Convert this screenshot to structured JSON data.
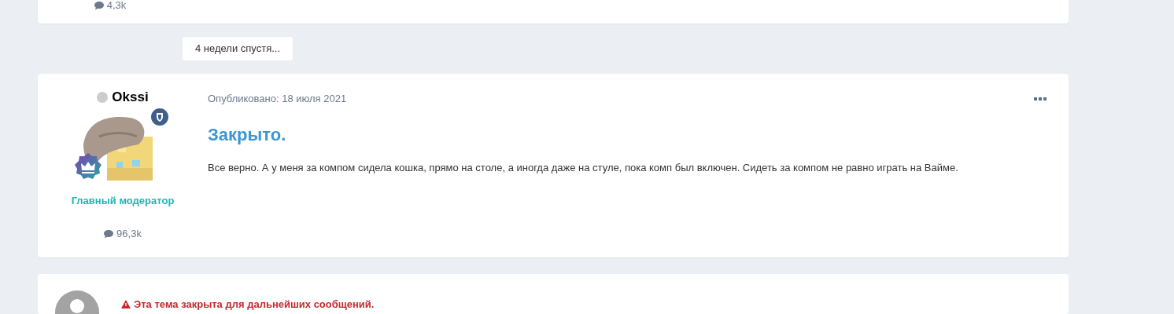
{
  "previous_post": {
    "count": "4,3k"
  },
  "time_gap": "4 недели спустя...",
  "post": {
    "author": {
      "name": "Okssi",
      "online": false,
      "role": "Главный модератор",
      "count": "96,3k"
    },
    "published": "Опубликовано: 18 июля 2021",
    "title": "Закрыто.",
    "body": "Все верно. А у меня за компом сидела кошка, прямо на столе, а иногда даже на стуле, пока комп был включен. Сидеть за компом не равно играть на Вайме."
  },
  "notice": "Эта тема закрыта для дальнейших сообщений."
}
